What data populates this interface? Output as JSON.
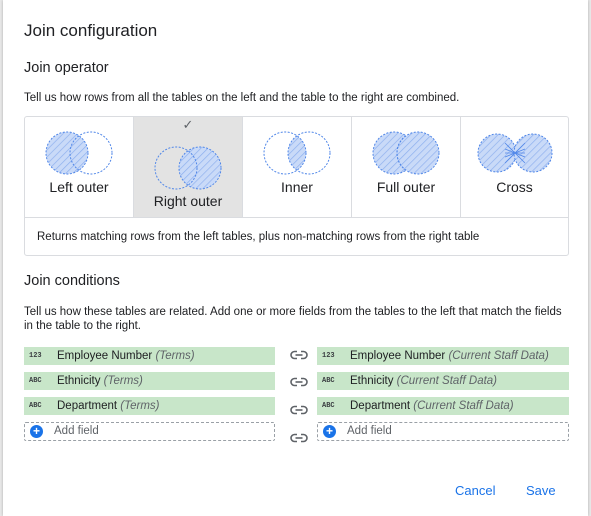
{
  "dialog": {
    "title": "Join configuration"
  },
  "operator": {
    "heading": "Join operator",
    "description": "Tell us how rows from all the tables on the left and the table to the right are combined.",
    "options": [
      {
        "label": "Left outer",
        "selected": false
      },
      {
        "label": "Right outer",
        "selected": true
      },
      {
        "label": "Inner",
        "selected": false
      },
      {
        "label": "Full outer",
        "selected": false
      },
      {
        "label": "Cross",
        "selected": false
      }
    ],
    "selected_check": "✓",
    "selected_description": "Returns matching rows from the left tables, plus non-matching rows from the right table"
  },
  "conditions": {
    "heading": "Join conditions",
    "description": "Tell us how these tables are related. Add one or more fields from the tables to the left that match the fields in the table to the right.",
    "left": [
      {
        "type": "123",
        "name": "Employee Number",
        "source": "(Terms)"
      },
      {
        "type": "ABC",
        "name": "Ethnicity",
        "source": "(Terms)"
      },
      {
        "type": "ABC",
        "name": "Department",
        "source": "(Terms)"
      }
    ],
    "right": [
      {
        "type": "123",
        "name": "Employee Number",
        "source": "(Current Staff Data)"
      },
      {
        "type": "ABC",
        "name": "Ethnicity",
        "source": "(Current Staff Data)"
      },
      {
        "type": "ABC",
        "name": "Department",
        "source": "(Current Staff Data)"
      }
    ],
    "add_field_label": "Add field",
    "add_icon": "+"
  },
  "buttons": {
    "cancel": "Cancel",
    "save": "Save"
  },
  "colors": {
    "accent": "#1a73e8",
    "field_bg": "#c8e6c9",
    "venn_fill": "#c7d7f7",
    "venn_stroke": "#4f86e8"
  }
}
